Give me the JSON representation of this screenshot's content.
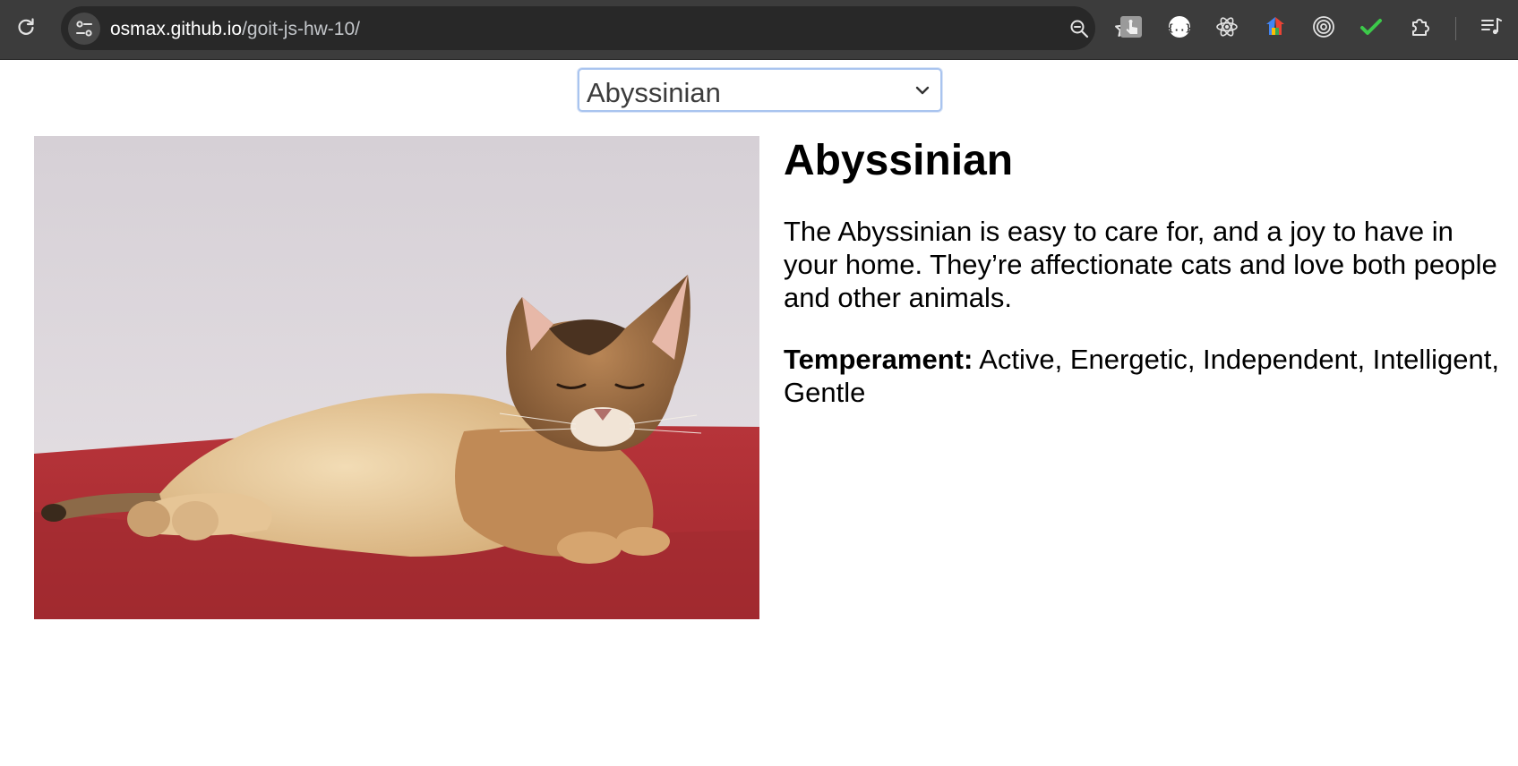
{
  "browser": {
    "url_host": "osmax.github.io",
    "url_path": "/goit-js-hw-10/",
    "icons": {
      "reload": "reload-icon",
      "site_info": "tune-icon",
      "zoom": "zoom-out-icon",
      "bookmark": "star-icon"
    },
    "extensions": [
      "extension-touch-icon",
      "extension-json-icon",
      "extension-react-icon",
      "extension-google-icon",
      "extension-target-icon",
      "extension-check-icon",
      "extensions-puzzle-icon",
      "reading-list-icon"
    ]
  },
  "breed_select": {
    "selected": "Abyssinian"
  },
  "cat": {
    "name": "Abyssinian",
    "description": "The Abyssinian is easy to care for, and a joy to have in your home. They’re affectionate cats and love both people and other animals.",
    "temperament_label": "Temperament:",
    "temperament": "Active, Energetic, Independent, Intelligent, Gentle"
  },
  "colors": {
    "toolbar": "#3c3c3c",
    "omnibox": "#282828",
    "select_border": "#a9c4ef",
    "photo_wall": "#d9d4d9",
    "photo_floor": "#b02f33"
  }
}
